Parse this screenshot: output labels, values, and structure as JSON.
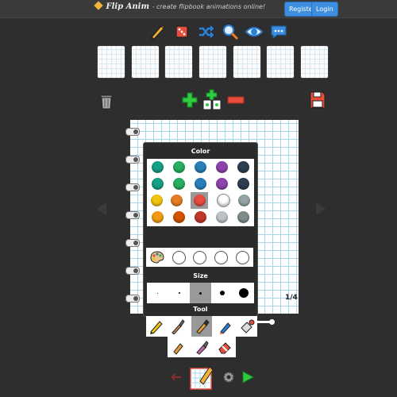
{
  "header": {
    "brand": "Flip Anim",
    "tagline": "- create flipbook animations online!",
    "register_label": "Register",
    "login_label": "Login"
  },
  "toolbar_icons": [
    "pencil-icon",
    "dice-icon",
    "shuffle-icon",
    "magnifier-icon",
    "eye-icon",
    "chat-icon"
  ],
  "frames": {
    "count": 7
  },
  "frame_actions": [
    "trash-icon",
    "add-frame-icon",
    "duplicate-frame-icon",
    "remove-frame-icon",
    "save-icon"
  ],
  "canvas": {
    "page_indicator": "1/4"
  },
  "panel": {
    "color_heading": "Color",
    "size_heading": "Size",
    "tool_heading": "Tool",
    "colors": [
      [
        "#16a085",
        "#27ae60",
        "#2980b9",
        "#8e44ad",
        "#2c3e50"
      ],
      [
        "#16a085",
        "#27ae60",
        "#2980b9",
        "#8e44ad",
        "#2c3e50"
      ],
      [
        "#f1c40f",
        "#e67e22",
        "#e74c3c",
        "#ffffff",
        "#95a5a6"
      ],
      [
        "#f39c12",
        "#d35400",
        "#c0392b",
        "#bdc3c7",
        "#7f8c8d"
      ]
    ],
    "selected_color": "#e74c3c",
    "custom_slots": 4,
    "sizes": [
      1,
      2,
      3,
      6,
      12
    ],
    "selected_size": 3,
    "tools_row1": [
      "pencil-tool-icon",
      "brush-tool-icon",
      "marker-tool-icon",
      "pen-tool-icon",
      "fill-tool-icon"
    ],
    "tools_row2": [
      "crayon-tool-icon",
      "spray-tool-icon",
      "eraser-tool-icon"
    ],
    "selected_tool": "marker-tool-icon"
  },
  "bottom_controls": [
    "undo-icon",
    "layer-icon",
    "settings-icon",
    "play-icon"
  ],
  "accent": "#3d8ee0"
}
